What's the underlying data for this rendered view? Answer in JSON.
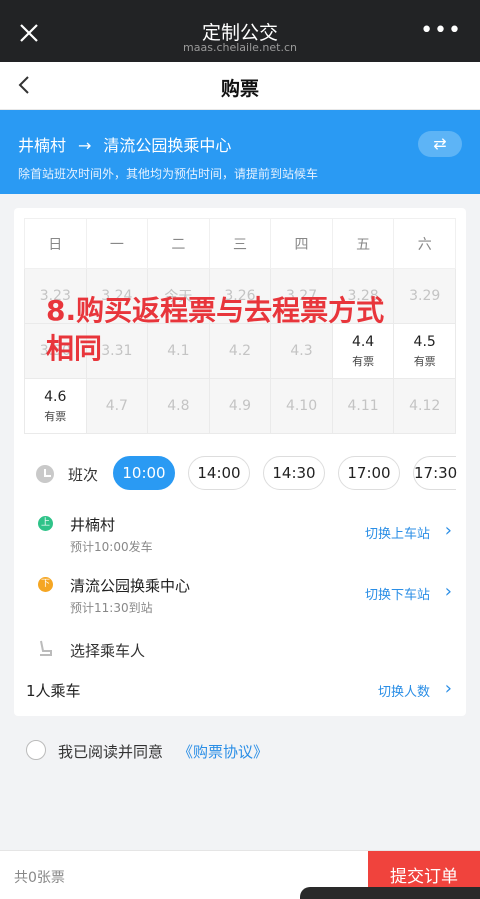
{
  "app": {
    "title": "定制公交",
    "domain": "maas.chelaile.net.cn"
  },
  "nav": {
    "title": "购票"
  },
  "route": {
    "from": "井楠村",
    "arrow": "→",
    "to": "清流公园换乘中心",
    "note": "除首站班次时间外，其他均为预估时间，请提前到站候车"
  },
  "calendar": {
    "weekdays": [
      "日",
      "一",
      "二",
      "三",
      "四",
      "五",
      "六"
    ],
    "rows": [
      [
        {
          "d": "3.23",
          "t": ""
        },
        {
          "d": "3.24",
          "t": ""
        },
        {
          "d": "今天",
          "t": ""
        },
        {
          "d": "3.26",
          "t": ""
        },
        {
          "d": "3.27",
          "t": ""
        },
        {
          "d": "3.28",
          "t": ""
        },
        {
          "d": "3.29",
          "t": ""
        }
      ],
      [
        {
          "d": "3.30",
          "t": ""
        },
        {
          "d": "3.31",
          "t": ""
        },
        {
          "d": "4.1",
          "t": ""
        },
        {
          "d": "4.2",
          "t": ""
        },
        {
          "d": "4.3",
          "t": ""
        },
        {
          "d": "4.4",
          "t": "有票"
        },
        {
          "d": "4.5",
          "t": "有票"
        }
      ],
      [
        {
          "d": "4.6",
          "t": "有票"
        },
        {
          "d": "4.7",
          "t": ""
        },
        {
          "d": "4.8",
          "t": ""
        },
        {
          "d": "4.9",
          "t": ""
        },
        {
          "d": "4.10",
          "t": ""
        },
        {
          "d": "4.11",
          "t": ""
        },
        {
          "d": "4.12",
          "t": ""
        }
      ]
    ]
  },
  "overlay": {
    "line1": "8.购买返程票与去程票方式",
    "line2": "相同"
  },
  "shift": {
    "label": "班次",
    "times": [
      "10:00",
      "14:00",
      "14:30",
      "17:00",
      "17:30"
    ]
  },
  "board": {
    "badge": "上",
    "name": "井楠村",
    "time": "预计10:00发车",
    "switch": "切换上车站"
  },
  "alight": {
    "badge": "下",
    "name": "清流公园换乘中心",
    "time": "预计11:30到站",
    "switch": "切换下车站"
  },
  "passenger": {
    "label": "选择乘车人",
    "count": "1人乘车",
    "switch": "切换人数"
  },
  "agree": {
    "text": "我已阅读并同意",
    "link": "《购票协议》"
  },
  "footer": {
    "total": "共0张票",
    "submit": "提交订单"
  },
  "colors": {
    "accent": "#2a9af3",
    "submit": "#f0433d",
    "board_dot": "#2fc389",
    "alight_dot": "#f5a623"
  }
}
